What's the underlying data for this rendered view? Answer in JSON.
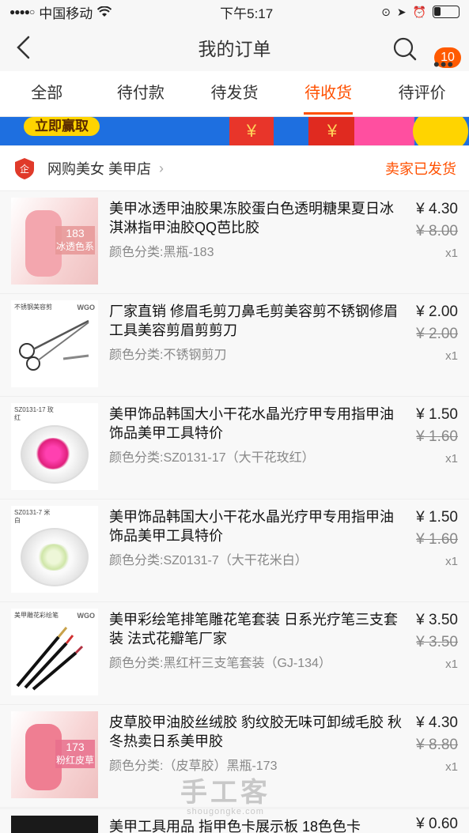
{
  "status_bar": {
    "carrier": "中国移动",
    "time": "下午5:17"
  },
  "nav": {
    "title": "我的订单",
    "badge": "10"
  },
  "tabs": [
    {
      "label": "全部",
      "active": false
    },
    {
      "label": "待付款",
      "active": false
    },
    {
      "label": "待发货",
      "active": false
    },
    {
      "label": "待收货",
      "active": true
    },
    {
      "label": "待评价",
      "active": false
    }
  ],
  "banner": {
    "button_label": "立即赢取"
  },
  "shop": {
    "name": "网购美女 美甲店",
    "status": "卖家已发货"
  },
  "items": [
    {
      "title": "美甲冰透甲油胶果冻胶蛋白色透明糖果夏日冰淇淋指甲油胶QQ芭比胶",
      "spec": "颜色分类:黑瓶-183",
      "price": "¥ 4.30",
      "orig": "¥ 8.00",
      "qty": "x1",
      "thumb_num": "183",
      "thumb_tag": "冰透色系"
    },
    {
      "title": "厂家直销 修眉毛剪刀鼻毛剪美容剪不锈钢修眉工具美容剪眉剪剪刀",
      "spec": "颜色分类:不锈钢剪刀",
      "price": "¥ 2.00",
      "orig": "¥ 2.00",
      "qty": "x1",
      "thumb_label": "不锈钢美容剪",
      "thumb_brand": "WGO"
    },
    {
      "title": "美甲饰品韩国大小干花水晶光疗甲专用指甲油饰品美甲工具特价",
      "spec": "颜色分类:SZ0131-17（大干花玫红）",
      "price": "¥ 1.50",
      "orig": "¥ 1.60",
      "qty": "x1",
      "thumb_label": "SZ0131-17 玫红"
    },
    {
      "title": "美甲饰品韩国大小干花水晶光疗甲专用指甲油饰品美甲工具特价",
      "spec": "颜色分类:SZ0131-7（大干花米白）",
      "price": "¥ 1.50",
      "orig": "¥ 1.60",
      "qty": "x1",
      "thumb_label": "SZ0131-7 米白"
    },
    {
      "title": "美甲彩绘笔排笔雕花笔套装 日系光疗笔三支套装 法式花瓣笔厂家",
      "spec": "颜色分类:黑红杆三支笔套装（GJ-134）",
      "price": "¥ 3.50",
      "orig": "¥ 3.50",
      "qty": "x1",
      "thumb_label": "美甲雕花彩绘笔",
      "thumb_brand": "WGO"
    },
    {
      "title": "皮草胶甲油胶丝绒胶 豹纹胶无味可卸绒毛胶 秋冬热卖日系美甲胶",
      "spec": "颜色分类:（皮草胶）黑瓶-173",
      "price": "¥ 4.30",
      "orig": "¥ 8.80",
      "qty": "x1",
      "thumb_num": "173",
      "thumb_tag": "粉红皮草"
    }
  ],
  "last_item": {
    "title": "美甲工具用品 指甲色卡展示板 18色色卡",
    "price": "¥ 0.60"
  },
  "watermark": {
    "big": "手工客",
    "small": "shougongke.com"
  },
  "colors": {
    "accent": "#ff5000",
    "badge": "#ff5a00"
  }
}
